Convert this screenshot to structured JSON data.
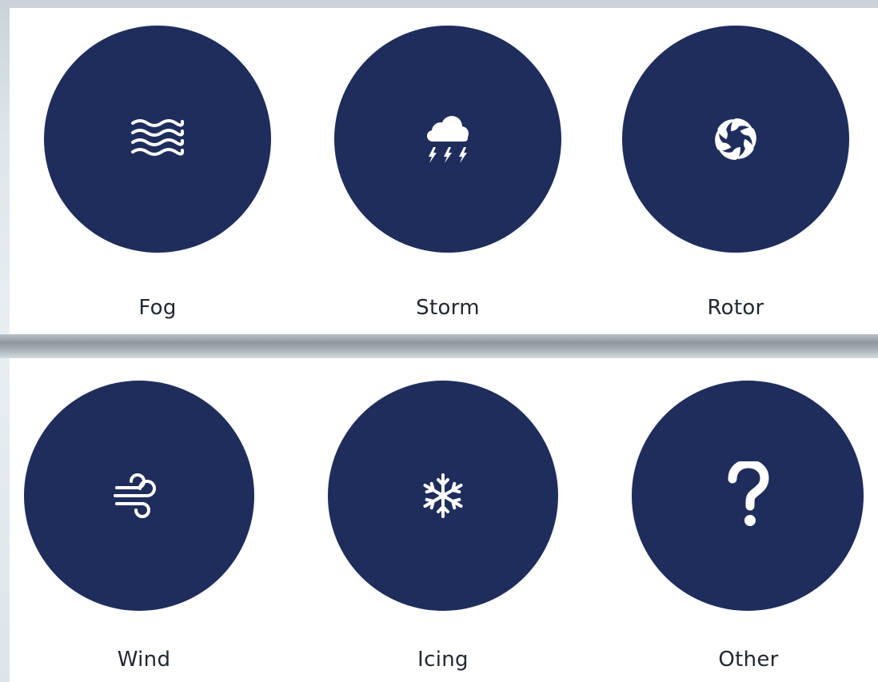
{
  "colors": {
    "circle_fill": "#1f2d5c",
    "icon_color": "#ffffff",
    "label_color": "#222831",
    "panel_bg": "#ffffff"
  },
  "options": [
    {
      "label": "Fog",
      "icon": "fog-icon"
    },
    {
      "label": "Storm",
      "icon": "storm-icon"
    },
    {
      "label": "Rotor",
      "icon": "rotor-icon"
    },
    {
      "label": "Wind",
      "icon": "wind-icon"
    },
    {
      "label": "Icing",
      "icon": "snowflake-icon"
    },
    {
      "label": "Other",
      "icon": "question-mark-icon"
    }
  ]
}
